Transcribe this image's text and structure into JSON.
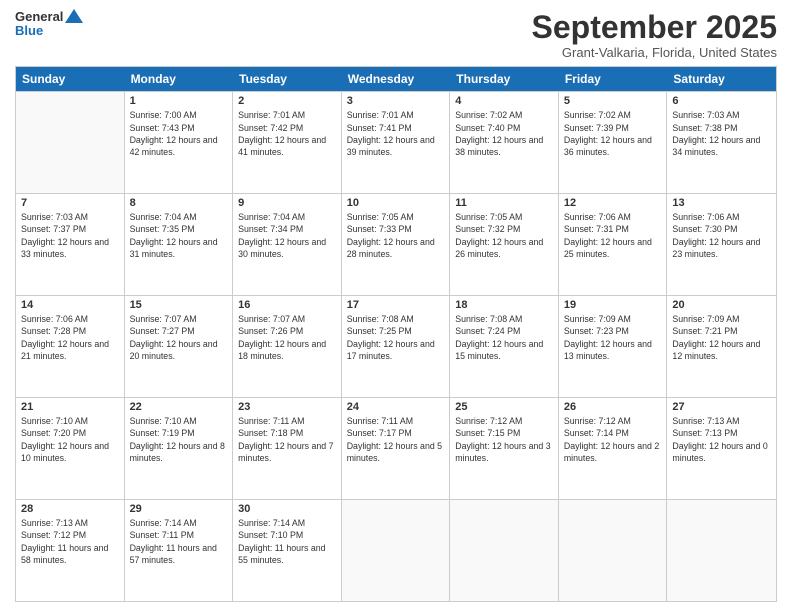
{
  "logo": {
    "line1": "General",
    "line2": "Blue"
  },
  "title": "September 2025",
  "location": "Grant-Valkaria, Florida, United States",
  "days": [
    "Sunday",
    "Monday",
    "Tuesday",
    "Wednesday",
    "Thursday",
    "Friday",
    "Saturday"
  ],
  "weeks": [
    [
      {
        "day": "",
        "sunrise": "",
        "sunset": "",
        "daylight": ""
      },
      {
        "day": "1",
        "sunrise": "Sunrise: 7:00 AM",
        "sunset": "Sunset: 7:43 PM",
        "daylight": "Daylight: 12 hours and 42 minutes."
      },
      {
        "day": "2",
        "sunrise": "Sunrise: 7:01 AM",
        "sunset": "Sunset: 7:42 PM",
        "daylight": "Daylight: 12 hours and 41 minutes."
      },
      {
        "day": "3",
        "sunrise": "Sunrise: 7:01 AM",
        "sunset": "Sunset: 7:41 PM",
        "daylight": "Daylight: 12 hours and 39 minutes."
      },
      {
        "day": "4",
        "sunrise": "Sunrise: 7:02 AM",
        "sunset": "Sunset: 7:40 PM",
        "daylight": "Daylight: 12 hours and 38 minutes."
      },
      {
        "day": "5",
        "sunrise": "Sunrise: 7:02 AM",
        "sunset": "Sunset: 7:39 PM",
        "daylight": "Daylight: 12 hours and 36 minutes."
      },
      {
        "day": "6",
        "sunrise": "Sunrise: 7:03 AM",
        "sunset": "Sunset: 7:38 PM",
        "daylight": "Daylight: 12 hours and 34 minutes."
      }
    ],
    [
      {
        "day": "7",
        "sunrise": "Sunrise: 7:03 AM",
        "sunset": "Sunset: 7:37 PM",
        "daylight": "Daylight: 12 hours and 33 minutes."
      },
      {
        "day": "8",
        "sunrise": "Sunrise: 7:04 AM",
        "sunset": "Sunset: 7:35 PM",
        "daylight": "Daylight: 12 hours and 31 minutes."
      },
      {
        "day": "9",
        "sunrise": "Sunrise: 7:04 AM",
        "sunset": "Sunset: 7:34 PM",
        "daylight": "Daylight: 12 hours and 30 minutes."
      },
      {
        "day": "10",
        "sunrise": "Sunrise: 7:05 AM",
        "sunset": "Sunset: 7:33 PM",
        "daylight": "Daylight: 12 hours and 28 minutes."
      },
      {
        "day": "11",
        "sunrise": "Sunrise: 7:05 AM",
        "sunset": "Sunset: 7:32 PM",
        "daylight": "Daylight: 12 hours and 26 minutes."
      },
      {
        "day": "12",
        "sunrise": "Sunrise: 7:06 AM",
        "sunset": "Sunset: 7:31 PM",
        "daylight": "Daylight: 12 hours and 25 minutes."
      },
      {
        "day": "13",
        "sunrise": "Sunrise: 7:06 AM",
        "sunset": "Sunset: 7:30 PM",
        "daylight": "Daylight: 12 hours and 23 minutes."
      }
    ],
    [
      {
        "day": "14",
        "sunrise": "Sunrise: 7:06 AM",
        "sunset": "Sunset: 7:28 PM",
        "daylight": "Daylight: 12 hours and 21 minutes."
      },
      {
        "day": "15",
        "sunrise": "Sunrise: 7:07 AM",
        "sunset": "Sunset: 7:27 PM",
        "daylight": "Daylight: 12 hours and 20 minutes."
      },
      {
        "day": "16",
        "sunrise": "Sunrise: 7:07 AM",
        "sunset": "Sunset: 7:26 PM",
        "daylight": "Daylight: 12 hours and 18 minutes."
      },
      {
        "day": "17",
        "sunrise": "Sunrise: 7:08 AM",
        "sunset": "Sunset: 7:25 PM",
        "daylight": "Daylight: 12 hours and 17 minutes."
      },
      {
        "day": "18",
        "sunrise": "Sunrise: 7:08 AM",
        "sunset": "Sunset: 7:24 PM",
        "daylight": "Daylight: 12 hours and 15 minutes."
      },
      {
        "day": "19",
        "sunrise": "Sunrise: 7:09 AM",
        "sunset": "Sunset: 7:23 PM",
        "daylight": "Daylight: 12 hours and 13 minutes."
      },
      {
        "day": "20",
        "sunrise": "Sunrise: 7:09 AM",
        "sunset": "Sunset: 7:21 PM",
        "daylight": "Daylight: 12 hours and 12 minutes."
      }
    ],
    [
      {
        "day": "21",
        "sunrise": "Sunrise: 7:10 AM",
        "sunset": "Sunset: 7:20 PM",
        "daylight": "Daylight: 12 hours and 10 minutes."
      },
      {
        "day": "22",
        "sunrise": "Sunrise: 7:10 AM",
        "sunset": "Sunset: 7:19 PM",
        "daylight": "Daylight: 12 hours and 8 minutes."
      },
      {
        "day": "23",
        "sunrise": "Sunrise: 7:11 AM",
        "sunset": "Sunset: 7:18 PM",
        "daylight": "Daylight: 12 hours and 7 minutes."
      },
      {
        "day": "24",
        "sunrise": "Sunrise: 7:11 AM",
        "sunset": "Sunset: 7:17 PM",
        "daylight": "Daylight: 12 hours and 5 minutes."
      },
      {
        "day": "25",
        "sunrise": "Sunrise: 7:12 AM",
        "sunset": "Sunset: 7:15 PM",
        "daylight": "Daylight: 12 hours and 3 minutes."
      },
      {
        "day": "26",
        "sunrise": "Sunrise: 7:12 AM",
        "sunset": "Sunset: 7:14 PM",
        "daylight": "Daylight: 12 hours and 2 minutes."
      },
      {
        "day": "27",
        "sunrise": "Sunrise: 7:13 AM",
        "sunset": "Sunset: 7:13 PM",
        "daylight": "Daylight: 12 hours and 0 minutes."
      }
    ],
    [
      {
        "day": "28",
        "sunrise": "Sunrise: 7:13 AM",
        "sunset": "Sunset: 7:12 PM",
        "daylight": "Daylight: 11 hours and 58 minutes."
      },
      {
        "day": "29",
        "sunrise": "Sunrise: 7:14 AM",
        "sunset": "Sunset: 7:11 PM",
        "daylight": "Daylight: 11 hours and 57 minutes."
      },
      {
        "day": "30",
        "sunrise": "Sunrise: 7:14 AM",
        "sunset": "Sunset: 7:10 PM",
        "daylight": "Daylight: 11 hours and 55 minutes."
      },
      {
        "day": "",
        "sunrise": "",
        "sunset": "",
        "daylight": ""
      },
      {
        "day": "",
        "sunrise": "",
        "sunset": "",
        "daylight": ""
      },
      {
        "day": "",
        "sunrise": "",
        "sunset": "",
        "daylight": ""
      },
      {
        "day": "",
        "sunrise": "",
        "sunset": "",
        "daylight": ""
      }
    ]
  ]
}
